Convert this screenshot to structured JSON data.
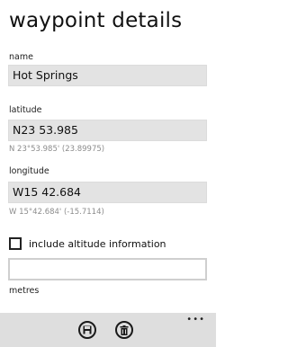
{
  "page": {
    "title": "waypoint details"
  },
  "name": {
    "label": "name",
    "value": "Hot Springs"
  },
  "latitude": {
    "label": "latitude",
    "value": "N23 53.985",
    "converted": "N 23°53.985' (23.89975)"
  },
  "longitude": {
    "label": "longitude",
    "value": "W15 42.684",
    "converted": "W 15°42.684' (-15.7114)"
  },
  "altitude": {
    "checkbox_label": "include altitude information",
    "checked": false,
    "value": "",
    "unit_label": "metres"
  },
  "appbar": {
    "buttons": [
      {
        "icon": "save-icon"
      },
      {
        "icon": "delete-icon"
      }
    ],
    "more_label": "•••"
  },
  "colors": {
    "field_bg": "#e3e3e3",
    "appbar_bg": "#dedede",
    "secondary_text": "#8c8c8c"
  }
}
